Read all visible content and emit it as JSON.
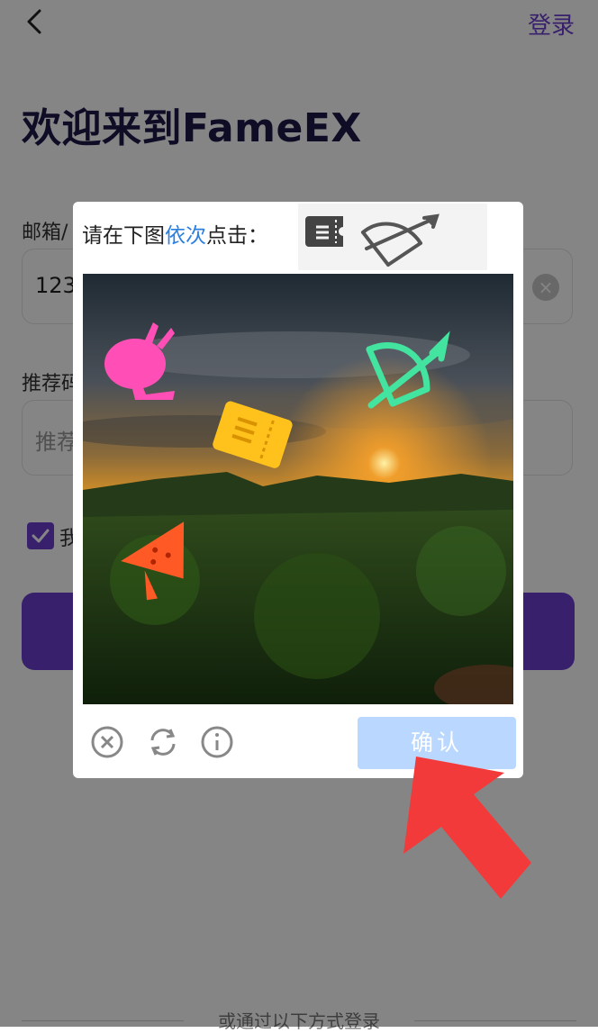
{
  "header": {
    "login_link": "登录"
  },
  "welcome_title": "欢迎来到FameEX",
  "form": {
    "email_label": "邮箱/",
    "email_value": "123",
    "referral_label": "推荐码",
    "referral_placeholder": "推荐",
    "agree_text": "我",
    "agree_checked": true
  },
  "footer": {
    "other_login": "或通过以下方式登录"
  },
  "captcha": {
    "prompt_prefix": "请在下图",
    "prompt_highlight": "依次",
    "prompt_suffix": "点击：",
    "target_icons": [
      "ticket-icon",
      "bow-arrow-icon"
    ],
    "scene_icons": [
      "rabbit-pot-icon",
      "ticket-icon",
      "bow-arrow-icon",
      "watermelon-icon"
    ],
    "confirm_label": "确认"
  },
  "colors": {
    "brand_purple": "#6b3fd1",
    "highlight_blue": "#2b7fe0",
    "confirm_disabled": "#b9d7ff",
    "arrow_red": "#f33a3a"
  }
}
